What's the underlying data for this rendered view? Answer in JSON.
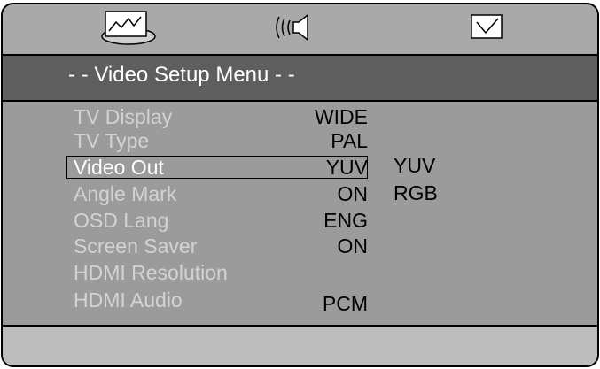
{
  "tabs": [
    {
      "icon": "video-setup-icon"
    },
    {
      "icon": "audio-setup-icon"
    },
    {
      "icon": "preference-checkbox-icon"
    }
  ],
  "header": {
    "title": "- - Video Setup Menu - -"
  },
  "menu": {
    "items": [
      {
        "label": "TV Display",
        "value": "WIDE"
      },
      {
        "label": "TV Type",
        "value": "PAL"
      },
      {
        "label": "Video Out",
        "value": "YUV",
        "selected": true
      },
      {
        "label": "Angle Mark",
        "value": "ON"
      },
      {
        "label": "OSD Lang",
        "value": "ENG"
      },
      {
        "label": "Screen Saver",
        "value": "ON"
      },
      {
        "label": "HDMI Resolution",
        "value": ""
      },
      {
        "label": "HDMI Audio",
        "value": "PCM"
      }
    ],
    "options": [
      "YUV",
      "RGB"
    ]
  },
  "colors": {
    "icon_bar": "#a9a9a9",
    "header_bg": "#5e5e5e",
    "content_bg": "#9b9b9b",
    "footer_bg": "#bdbdbd",
    "label_text": "#d3d3d3"
  }
}
